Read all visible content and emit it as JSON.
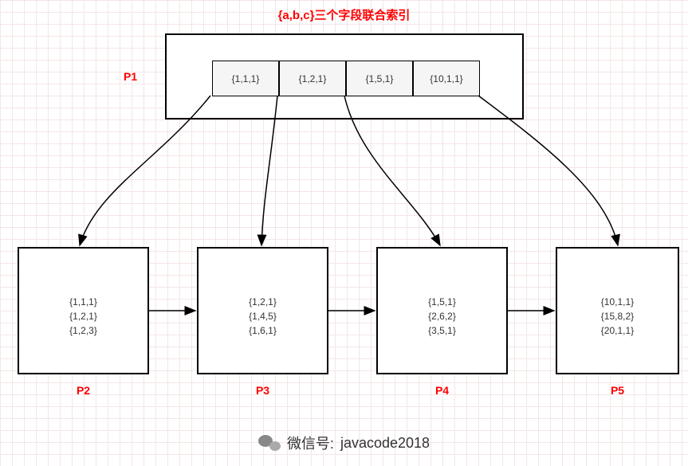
{
  "title": "{a,b,c}三个字段联合索引",
  "root": {
    "label": "P1",
    "keys": [
      "{1,1,1}",
      "{1,2,1}",
      "{1,5,1}",
      "{10,1,1}"
    ]
  },
  "leaves": [
    {
      "label": "P2",
      "rows": [
        "{1,1,1}",
        "{1,2,1}",
        "{1,2,3}"
      ]
    },
    {
      "label": "P3",
      "rows": [
        "{1,2,1}",
        "{1,4,5}",
        "{1,6,1}"
      ]
    },
    {
      "label": "P4",
      "rows": [
        "{1,5,1}",
        "{2,6,2}",
        "{3,5,1}"
      ]
    },
    {
      "label": "P5",
      "rows": [
        "{10,1,1}",
        "{15,8,2}",
        "{20,1,1}"
      ]
    }
  ],
  "footer": {
    "prefix": "微信号:",
    "account": "javacode2018"
  }
}
